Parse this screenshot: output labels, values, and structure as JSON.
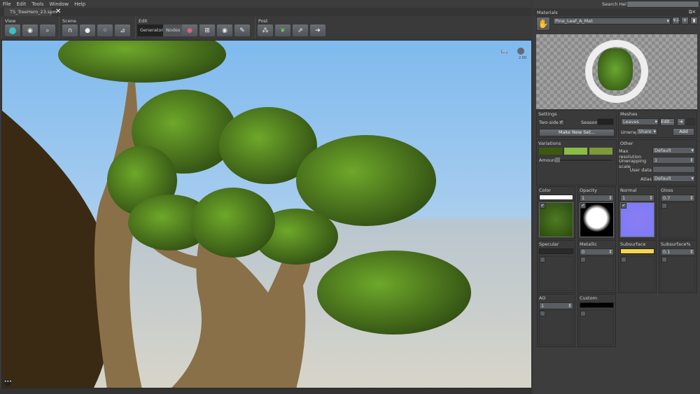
{
  "menu": [
    "File",
    "Edit",
    "Tools",
    "Window",
    "Help"
  ],
  "document_tab": "TS_TreeHero_23.spm",
  "toolbar": {
    "groups": [
      {
        "label": "View",
        "icons": [
          "globe-icon",
          "orbit-camera-icon",
          "zoom-icon"
        ]
      },
      {
        "label": "Scene",
        "icons": [
          "wind-curve-icon",
          "light-icon",
          "particles-icon",
          "fan-icon"
        ]
      },
      {
        "label": "Edit",
        "segments": [
          "Generators",
          "Nodes"
        ],
        "icons": [
          "paint-icon",
          "add-node-icon",
          "eye-icon",
          "brush-icon"
        ]
      },
      {
        "label": "Post",
        "icons": [
          "cluster-icon",
          "leaf-icon",
          "export-icon",
          "arrow-right-icon"
        ]
      }
    ]
  },
  "viewport": {
    "gizmo_value": "2.00",
    "axis_label": "x"
  },
  "search_help": {
    "label": "Search Help:",
    "value": ""
  },
  "materials": {
    "title": "Materials",
    "selected": "Pine_Leaf_A_Mat",
    "plusminus": "+/-",
    "add": "+",
    "settings": {
      "title": "Settings",
      "two_sided_label": "Two-sided",
      "two_sided": true,
      "season_label": "Season",
      "make_new_set": "Make New Set..."
    },
    "meshes": {
      "title": "Meshes",
      "mesh": "Leaves",
      "edit": "Edit...",
      "unwrap_label": "Unwrap",
      "unwrap": "Share",
      "add": "Add"
    },
    "variations": {
      "title": "Variations",
      "colors": [
        "#3c5a0e",
        "#8cbc44",
        "#7c9a3c"
      ],
      "amount_label": "Amount",
      "amount": 0
    },
    "other": {
      "title": "Other",
      "max_res_label": "Max resolution",
      "max_res": "Default",
      "unwrap_scale_label": "Unwrapping scale",
      "unwrap_scale": "1",
      "user_data_label": "User data",
      "user_data": "",
      "atlas_label": "Atlas",
      "atlas": "Default"
    },
    "channels": [
      {
        "label": "Color",
        "swatch": "#ffffff",
        "checked": true,
        "texture": "leaf-color"
      },
      {
        "label": "Opacity",
        "value": "1",
        "checked": true,
        "texture": "leaf-opacity"
      },
      {
        "label": "Normal",
        "value": "1",
        "checked": true,
        "texture": "leaf-normal"
      },
      {
        "label": "Gloss",
        "value": "0.7",
        "checked": false
      },
      {
        "label": "Specular",
        "swatch": "#2a2a2a",
        "checked": false
      },
      {
        "label": "Metallic",
        "value": "0",
        "checked": false
      },
      {
        "label": "Subsurface",
        "swatch": "#f4d84a",
        "checked": false
      },
      {
        "label": "Subsurface%",
        "value": "0.1",
        "checked": false
      },
      {
        "label": "AO",
        "value": "1",
        "checked": false
      },
      {
        "label": "Custom",
        "swatch": "#000000",
        "checked": false
      }
    ]
  }
}
